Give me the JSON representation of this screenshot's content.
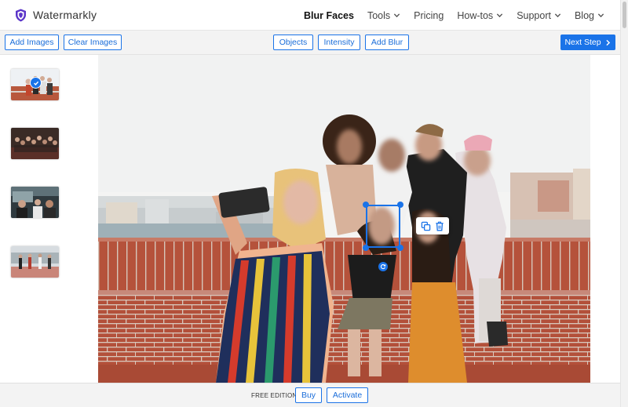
{
  "app": {
    "name": "Watermarkly"
  },
  "nav": {
    "items": [
      {
        "label": "Blur Faces",
        "active": true,
        "dropdown": false
      },
      {
        "label": "Tools",
        "active": false,
        "dropdown": true
      },
      {
        "label": "Pricing",
        "active": false,
        "dropdown": false
      },
      {
        "label": "How-tos",
        "active": false,
        "dropdown": true
      },
      {
        "label": "Support",
        "active": false,
        "dropdown": true
      },
      {
        "label": "Blog",
        "active": false,
        "dropdown": true
      }
    ]
  },
  "toolbar": {
    "add_images": "Add Images",
    "clear_images": "Clear Images",
    "objects": "Objects",
    "intensity": "Intensity",
    "add_blur": "Add Blur",
    "next_step": "Next Step"
  },
  "bottom": {
    "edition": "FREE EDITION",
    "buy": "Buy",
    "activate": "Activate"
  },
  "colors": {
    "accent": "#1a73e8",
    "brand": "#5b35c9",
    "selection": "#1a73e8"
  },
  "icons": {
    "logo": "shield-icon",
    "dropdown": "chevron-down-icon",
    "next": "chevron-right-icon",
    "selected": "check-icon",
    "duplicate": "duplicate-icon",
    "delete": "trash-icon",
    "rotate": "rotate-icon"
  }
}
